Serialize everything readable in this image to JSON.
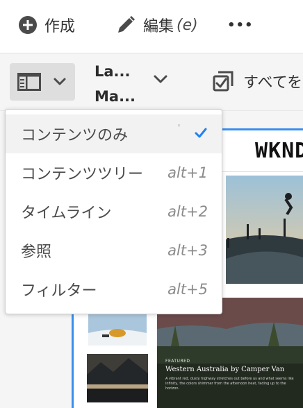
{
  "actionbar": {
    "create_label": "作成",
    "edit_label": "編集",
    "edit_shortcut": "(e)",
    "more_label": "•••"
  },
  "toolbar": {
    "view_switcher_icon": "rail-layout-icon",
    "breadcrumb_line1": "La...",
    "breadcrumb_line2": "Ma...",
    "select_all_label": "すべてを"
  },
  "content_preview": {
    "logo_text": "WKND",
    "featured_tag": "FEATURED",
    "hero_title": "Western Australia by Camper Van",
    "hero_desc": "A vibrant red, dusty highway stretches out before us and what seems like infinity, the colors shimmer from the afternoon heat, fading up to the horizon."
  },
  "view_menu": {
    "items": [
      {
        "label": "コンテンツのみ",
        "shortcut": "",
        "tick": "'",
        "selected": true
      },
      {
        "label": "コンテンツツリー",
        "shortcut": "alt+1",
        "selected": false
      },
      {
        "label": "タイムライン",
        "shortcut": "alt+2",
        "selected": false
      },
      {
        "label": "参照",
        "shortcut": "alt+3",
        "selected": false
      },
      {
        "label": "フィルター",
        "shortcut": "alt+5",
        "selected": false
      }
    ]
  },
  "colors": {
    "accent": "#378ef0",
    "checkmark": "#2680eb",
    "menu_selected_bg": "#f2f2f2"
  }
}
